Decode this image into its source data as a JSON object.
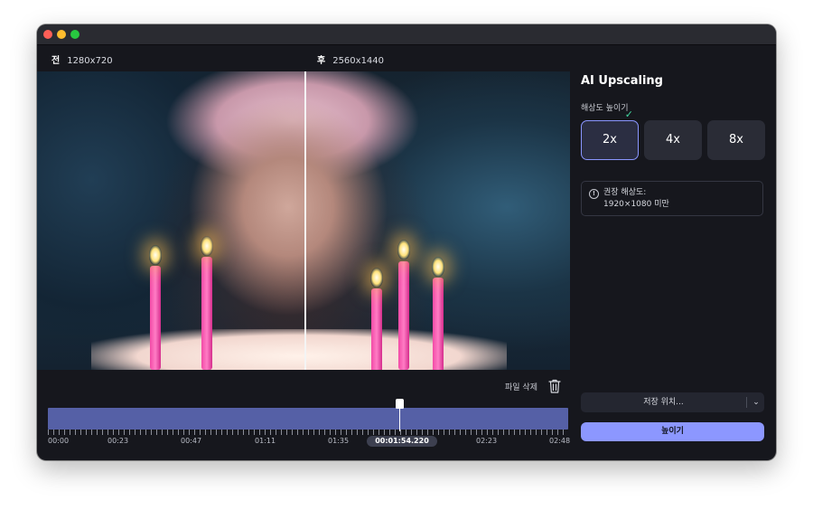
{
  "compare": {
    "before_tag": "전",
    "before_res": "1280x720",
    "after_tag": "후",
    "after_res": "2560x1440"
  },
  "video": {
    "delete_label": "파일 삭제",
    "timeline": {
      "labels": [
        "00:00",
        "00:23",
        "00:47",
        "01:11",
        "01:35",
        "02:23",
        "02:48"
      ],
      "current_time": "00:01:54.220",
      "playhead_position": 0.676
    }
  },
  "panel": {
    "title": "AI Upscaling",
    "section_label": "해상도 높이기",
    "scale_options": [
      {
        "label": "2x",
        "selected": true
      },
      {
        "label": "4x",
        "selected": false
      },
      {
        "label": "8x",
        "selected": false
      }
    ],
    "info": {
      "line1": "권장 해상도:",
      "line2": "1920×1080 미만"
    },
    "save_location_label": "저장 위치...",
    "upscale_button": "높이기"
  },
  "colors": {
    "accent": "#8c97ff",
    "check": "#42d9a0",
    "timeline_fill": "#5560a6"
  }
}
